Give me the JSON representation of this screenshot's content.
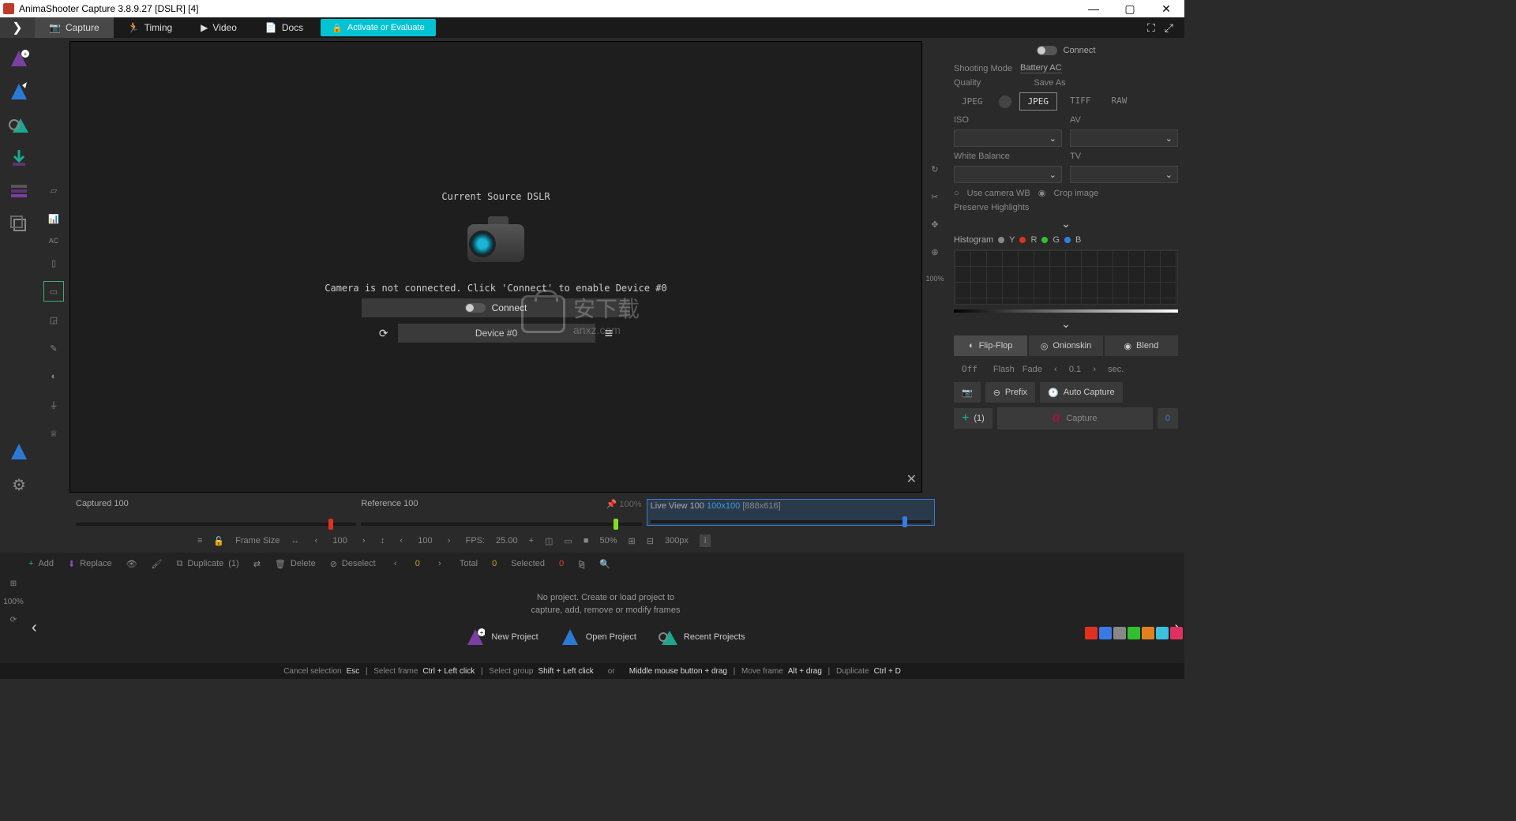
{
  "title": "AnimaShooter Capture 3.8.9.27 [DSLR] [4]",
  "tabs": {
    "capture": "Capture",
    "timing": "Timing",
    "video": "Video",
    "docs": "Docs",
    "activate": "Activate or Evaluate"
  },
  "viewport": {
    "source": "Current Source DSLR",
    "notConnected": "Camera is not connected. Click 'Connect' to enable Device #0",
    "connect": "Connect",
    "device": "Device #0"
  },
  "toolrail": {
    "ac": "AC"
  },
  "viewportRail": {
    "pct": "100%"
  },
  "sliders": {
    "captured": {
      "label": "Captured",
      "val": "100"
    },
    "reference": {
      "label": "Reference",
      "val": "100",
      "pct": "100%"
    },
    "live": {
      "label": "Live View",
      "val": "100",
      "res": "100x100",
      "dim": "[888x616]"
    }
  },
  "controls": {
    "frameSize": "Frame Size",
    "fs_val": "100",
    "step_val": "100",
    "fps": "FPS:",
    "fps_val": "25.00",
    "zoom": "50%",
    "grid_px": "300px"
  },
  "edit": {
    "add": "Add",
    "replace": "Replace",
    "duplicate": "Duplicate",
    "dup_n": "(1)",
    "delete": "Delete",
    "deselect": "Deselect",
    "cur": "0",
    "total": "Total",
    "total_n": "0",
    "selected": "Selected",
    "sel_n": "0"
  },
  "timeline": {
    "msg1": "No project. Create or load project to",
    "msg2": "capture, add, remove or modify frames",
    "new": "New Project",
    "open": "Open Project",
    "recent": "Recent Projects",
    "rail_pct": "100%"
  },
  "right": {
    "connect": "Connect",
    "shootingMode": "Shooting Mode",
    "battery": "Battery AC",
    "quality": "Quality",
    "saveAs": "Save As",
    "jpeg": "JPEG",
    "jpeg2": "JPEG",
    "tiff": "TIFF",
    "raw": "RAW",
    "iso": "ISO",
    "av": "AV",
    "wb": "White Balance",
    "tv": "TV",
    "useCam": "Use camera WB",
    "crop": "Crop image",
    "preserve": "Preserve Highlights",
    "hist": "Histogram",
    "y": "Y",
    "r": "R",
    "g": "G",
    "b": "B",
    "flipflop": "Flip-Flop",
    "onion": "Onionskin",
    "blend": "Blend",
    "off": "Off",
    "flash": "Flash",
    "fade": "Fade",
    "fade_val": "0.1",
    "sec": "sec.",
    "prefix": "Prefix",
    "auto": "Auto Capture",
    "plus_n": "(1)",
    "capture": "Capture",
    "cap_n": "0"
  },
  "shortcuts": {
    "cancel": "Cancel selection",
    "cancel_k": "Esc",
    "sel": "Select frame",
    "sel_k": "Ctrl + Left click",
    "grp": "Select group",
    "grp_k": "Shift + Left click",
    "or": "or",
    "grp_k2": "Middle mouse button + drag",
    "mv": "Move frame",
    "mv_k": "Alt + drag",
    "dup": "Duplicate",
    "dup_k": "Ctrl + D"
  }
}
